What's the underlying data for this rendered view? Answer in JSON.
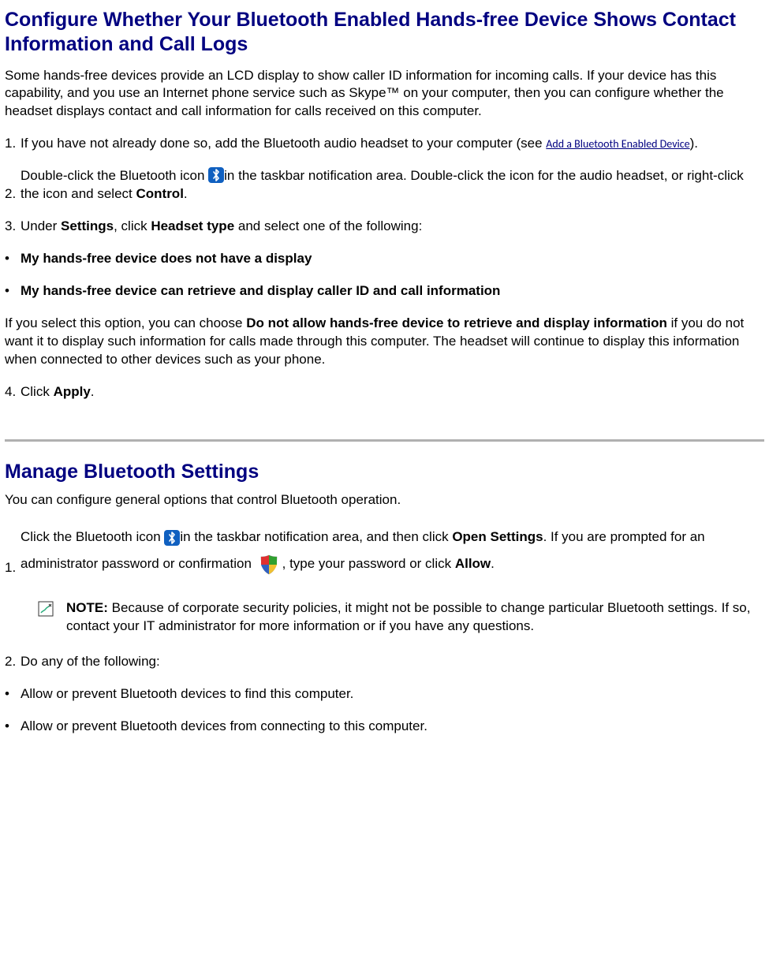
{
  "section1": {
    "heading": "Configure Whether Your Bluetooth Enabled Hands-free Device Shows Contact Information and Call Logs",
    "intro": "Some hands-free devices provide an LCD display to show caller ID information for incoming calls. If your device has this capability, and you use an Internet phone service such as Skype™ on your computer, then you can configure whether the headset displays contact and call information for calls received on this computer.",
    "step1_pre": "If you have not already done so, add the Bluetooth audio headset to your computer (see ",
    "step1_link": "Add a Bluetooth Enabled Device",
    "step1_post": ").",
    "step2_pre": "Double-click the Bluetooth icon ",
    "step2_mid": "in the taskbar notification area. Double-click the icon for the audio headset, or right-click the icon and select ",
    "step2_bold": "Control",
    "step2_end": ".",
    "step3_a": "Under ",
    "step3_b": "Settings",
    "step3_c": ", click ",
    "step3_d": "Headset type",
    "step3_e": " and select one of the following:",
    "bullet1": "My hands-free device does not have a display",
    "bullet2": "My hands-free device can retrieve and display caller ID and call information",
    "para_a": "If you select this option, you can choose ",
    "para_b": "Do not allow hands-free device to retrieve and display information",
    "para_c": " if you do not want it to display such information for calls made through this computer. The headset will continue to display this information when connected to other devices such as your phone.",
    "step4_a": "Click ",
    "step4_b": "Apply",
    "step4_c": "."
  },
  "section2": {
    "heading": "Manage Bluetooth Settings",
    "intro": "You can configure general options that control Bluetooth operation.",
    "step1_a": "Click the Bluetooth icon ",
    "step1_b": "in the taskbar notification area, and then click ",
    "step1_c": "Open Settings",
    "step1_d": ". If you are prompted for an administrator password or confirmation ",
    "step1_e": ", type your password or click ",
    "step1_f": "Allow",
    "step1_g": ".",
    "note_label": "NOTE:",
    "note_body": " Because of corporate security policies, it might not be possible to change particular Bluetooth settings. If so, contact your IT administrator for more information or if you have any questions.",
    "step2": "Do any of the following:",
    "bullet1": "Allow or prevent Bluetooth devices to find this computer.",
    "bullet2": "Allow or prevent Bluetooth devices from connecting to this computer."
  },
  "labels": {
    "n1": "1.",
    "n2": "2.",
    "n3": "3.",
    "n4": "4.",
    "bullet": "•"
  }
}
